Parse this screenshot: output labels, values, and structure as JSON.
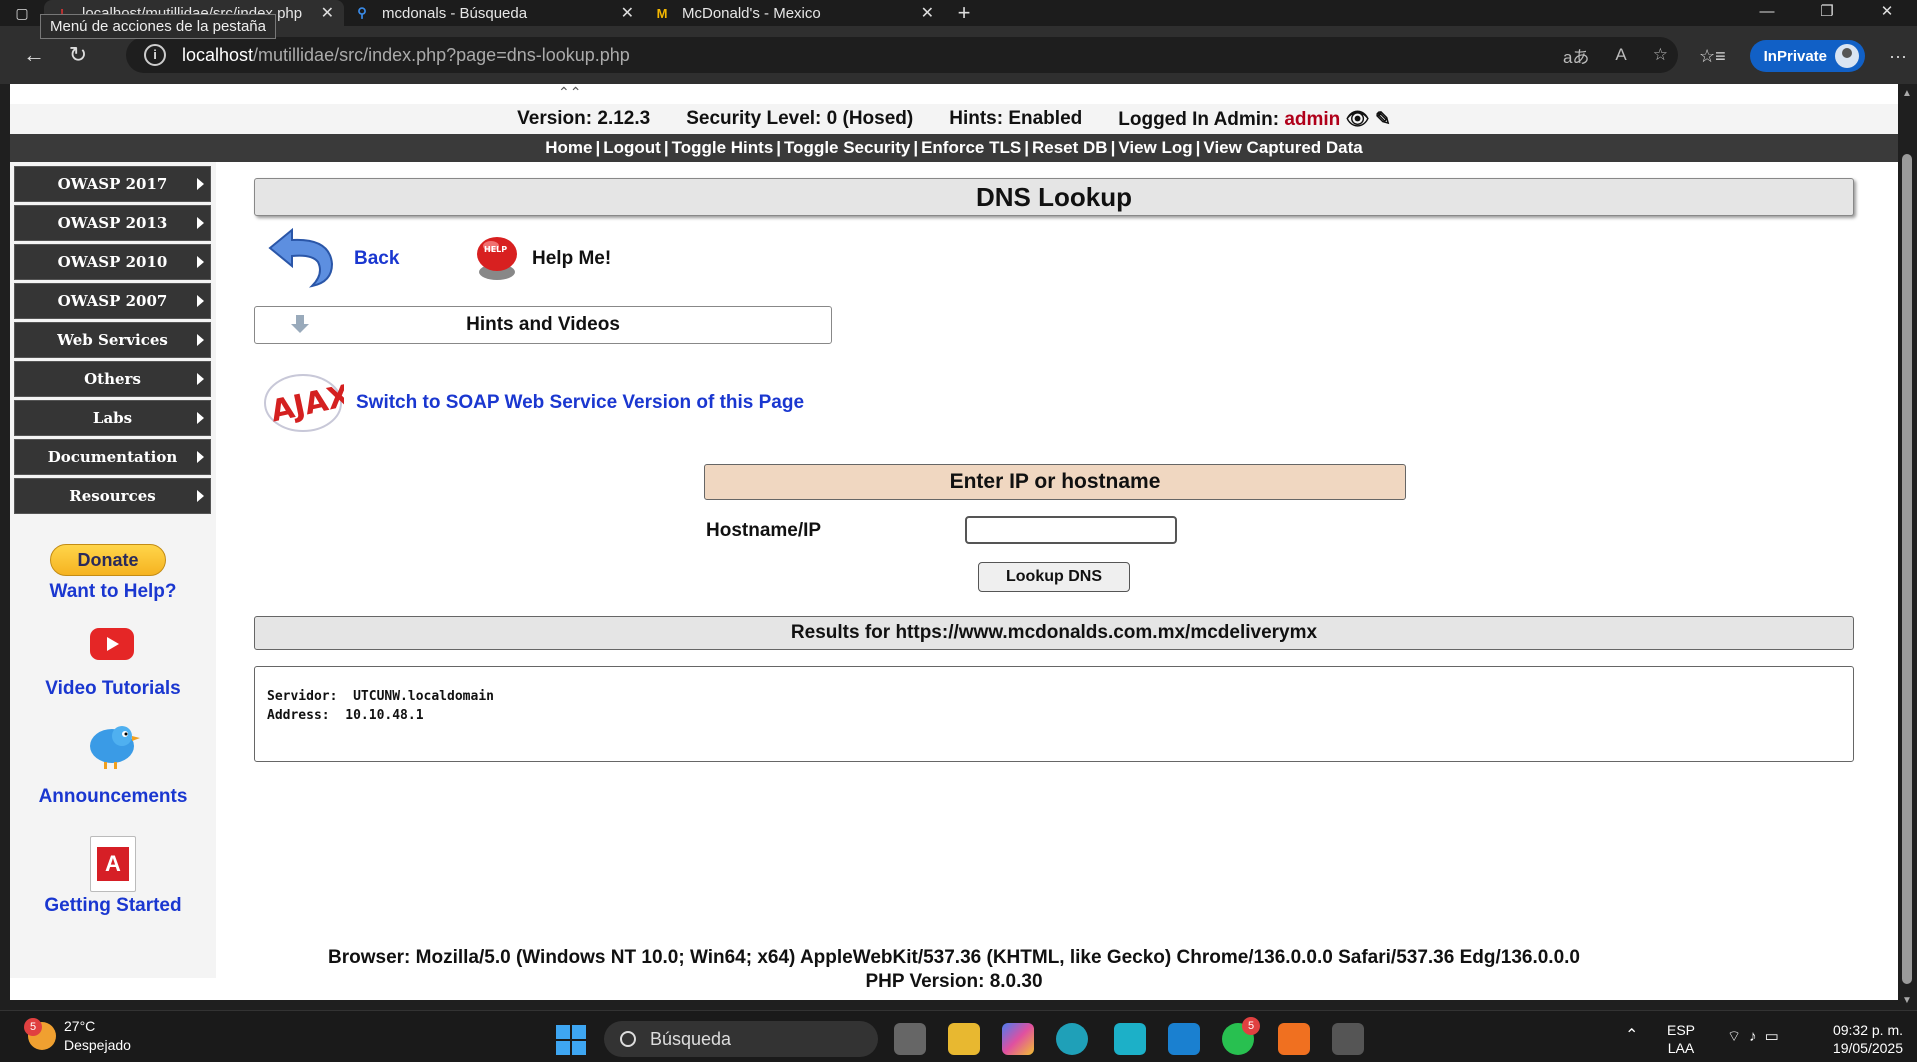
{
  "browser": {
    "tooltip": "Menú de acciones de la pestaña",
    "tabs": [
      {
        "title": "localhost/mutillidae/src/index.php",
        "icon": "mutillidae-icon",
        "active": true
      },
      {
        "title": "mcdonals - Búsqueda",
        "icon": "search-icon",
        "active": false
      },
      {
        "title": "McDonald's - Mexico",
        "icon": "mcdonalds-icon",
        "active": false
      }
    ],
    "address": {
      "host": "localhost",
      "path": "/mutillidae/src/index.php?page=dns-lookup.php"
    },
    "inprivate_label": "InPrivate"
  },
  "header": {
    "version": "Version: 2.12.3",
    "security": "Security Level: 0 (Hosed)",
    "hints": "Hints: Enabled",
    "logged_label": "Logged In Admin:",
    "logged_user": "admin",
    "menu": [
      "Home",
      "Logout",
      "Toggle Hints",
      "Toggle Security",
      "Enforce TLS",
      "Reset DB",
      "View Log",
      "View Captured Data"
    ]
  },
  "sidebar": {
    "items": [
      "OWASP 2017",
      "OWASP 2013",
      "OWASP 2010",
      "OWASP 2007",
      "Web Services",
      "Others",
      "Labs",
      "Documentation",
      "Resources"
    ],
    "donate": "Donate",
    "want_help": "Want to Help?",
    "video_tutorials": "Video Tutorials",
    "announcements": "Announcements",
    "getting_started": "Getting Started"
  },
  "content": {
    "title": "DNS Lookup",
    "back": "Back",
    "help": "Help Me!",
    "hints_videos": "Hints and Videos",
    "soap_link": "Switch to SOAP Web Service Version of this Page",
    "form_title": "Enter IP or hostname",
    "hostname_label": "Hostname/IP",
    "hostname_value": "",
    "lookup_button": "Lookup DNS",
    "results_title": "Results for https://www.mcdonalds.com.mx/mcdeliverymx",
    "results_text": "Servidor:  UTCUNW.localdomain\nAddress:  10.10.48.1"
  },
  "footer": {
    "browser": "Browser: Mozilla/5.0 (Windows NT 10.0; Win64; x64) AppleWebKit/537.36 (KHTML, like Gecko) Chrome/136.0.0.0 Safari/537.36 Edg/136.0.0.0",
    "php": "PHP Version: 8.0.30"
  },
  "taskbar": {
    "weather_badge": "5",
    "temp": "27°C",
    "condition": "Despejado",
    "search": "Búsqueda",
    "whatsapp_badge": "5",
    "lang_top": "ESP",
    "lang_bottom": "LAA",
    "time": "09:32 p. m.",
    "date": "19/05/2025"
  }
}
